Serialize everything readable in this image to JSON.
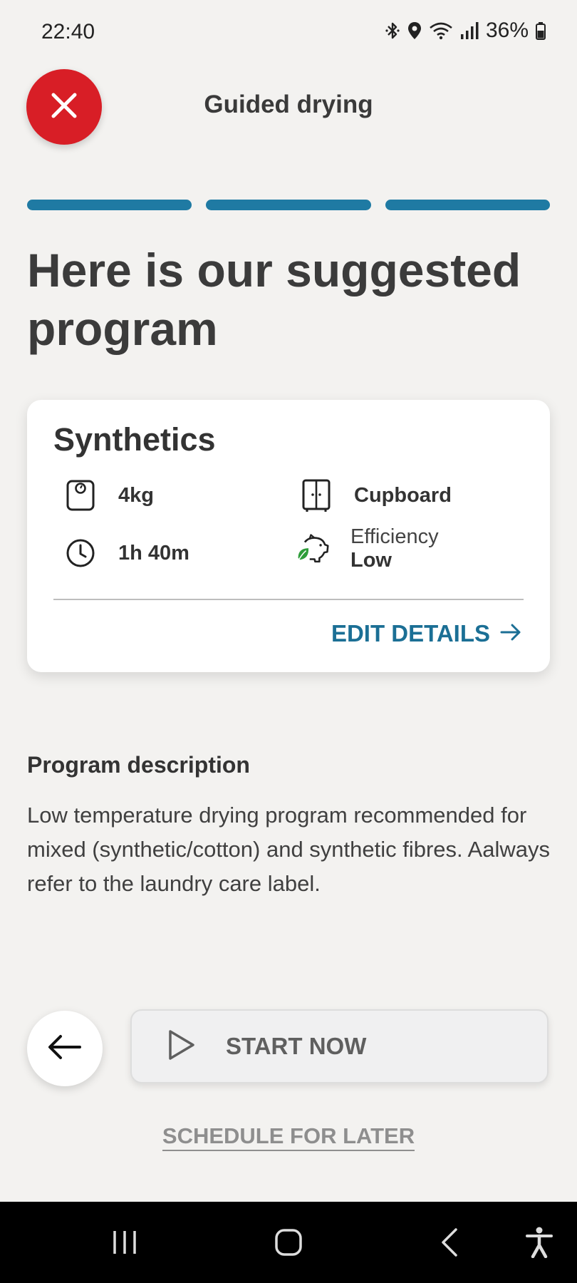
{
  "status_bar": {
    "time": "22:40",
    "battery": "36%",
    "icons": [
      "bluetooth-icon",
      "location-icon",
      "wifi-icon",
      "signal-icon",
      "battery-icon"
    ]
  },
  "header": {
    "title": "Guided drying",
    "close_icon": "close-icon"
  },
  "progress": {
    "steps_total": 3,
    "steps_complete": 3,
    "color": "#1f7aa3"
  },
  "headline": "Here is our suggested program",
  "program_card": {
    "name": "Synthetics",
    "weight": "4kg",
    "destination": "Cupboard",
    "duration": "1h 40m",
    "efficiency_label": "Efficiency",
    "efficiency_value": "Low",
    "edit_label": "EDIT DETAILS",
    "icons": {
      "weight": "weight-scale-icon",
      "destination": "cupboard-icon",
      "duration": "clock-icon",
      "efficiency": "piggy-bank-leaf-icon",
      "edit": "arrow-right-icon"
    }
  },
  "description": {
    "title": "Program description",
    "body": "Low temperature drying program recommended for mixed (synthetic/cotton) and synthetic fibres. Aalways refer to the laundry care label."
  },
  "actions": {
    "back_icon": "arrow-left-icon",
    "start_label": "START NOW",
    "start_icon": "play-icon",
    "schedule_label": "SCHEDULE FOR LATER"
  },
  "colors": {
    "accent": "#1f7aa3",
    "close": "#d81e26",
    "leaf": "#2e9d3a"
  },
  "nav_bar": {
    "icons": [
      "recent-apps-icon",
      "home-icon",
      "back-icon",
      "accessibility-icon"
    ]
  }
}
